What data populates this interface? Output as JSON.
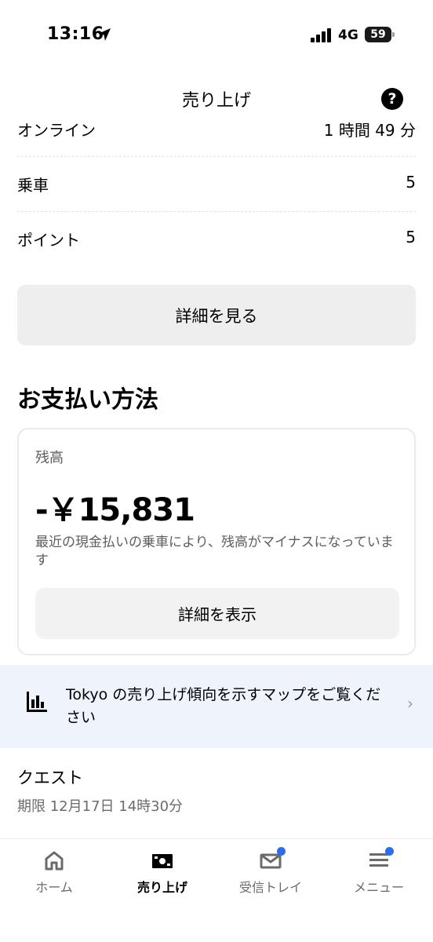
{
  "status_bar": {
    "time": "13:16",
    "network": "4G",
    "battery_level": "59"
  },
  "header": {
    "title": "売り上げ",
    "help_icon": "?"
  },
  "stats": [
    {
      "label": "オンライン",
      "value": "1 時間 49 分"
    },
    {
      "label": "乗車",
      "value": "5"
    },
    {
      "label": "ポイント",
      "value": "5"
    }
  ],
  "details_button_label": "詳細を見る",
  "payment": {
    "section_title": "お支払い方法",
    "balance_label": "残高",
    "balance_amount": "-￥15,831",
    "balance_note": "最近の現金払いの乗車により、残高がマイナスになっています",
    "show_details_label": "詳細を表示"
  },
  "map_banner": {
    "text": "Tokyo の売り上げ傾向を示すマップをご覧ください",
    "chevron": "›"
  },
  "quest": {
    "title": "クエスト",
    "deadline": "期限 12月17日 14時30分"
  },
  "bottom_nav": {
    "items": [
      {
        "label": "ホーム",
        "icon": "home-icon"
      },
      {
        "label": "売り上げ",
        "icon": "earnings-icon",
        "active": true
      },
      {
        "label": "受信トレイ",
        "icon": "mail-icon",
        "badge": true
      },
      {
        "label": "メニュー",
        "icon": "menu-icon",
        "badge": true
      }
    ]
  },
  "colors": {
    "accent_blue": "#276ef1",
    "banner_bg": "#eef3fc",
    "button_bg": "#eeeeee"
  }
}
